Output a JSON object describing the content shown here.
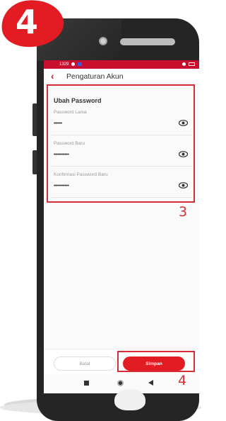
{
  "step_badge": "4",
  "statusbar": {
    "left_text": "1329",
    "right_text": ""
  },
  "appbar": {
    "title": "Pengaturan Akun"
  },
  "section": {
    "title": "Ubah Password"
  },
  "fields": [
    {
      "label": "Password Lama",
      "value": "••••••"
    },
    {
      "label": "Password Baru",
      "value": "•••••••••••"
    },
    {
      "label": "Konfirmasi Password Baru",
      "value": "•••••••••••"
    }
  ],
  "annotations": {
    "box_fields": "3",
    "box_save": "4"
  },
  "buttons": {
    "cancel": "Batal",
    "save": "Simpan"
  },
  "colors": {
    "brand": "#e31b23",
    "highlight": "#d62f3a"
  },
  "icons": {
    "back": "chevron-left-icon",
    "eye": "eye-icon"
  }
}
